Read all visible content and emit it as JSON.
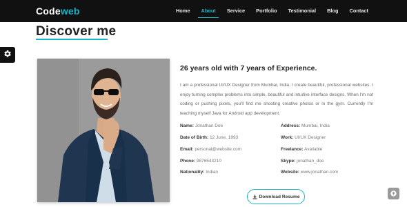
{
  "brand": {
    "part1": "Code",
    "part2": "web"
  },
  "nav": {
    "items": [
      {
        "label": "Home",
        "active": false
      },
      {
        "label": "About",
        "active": true
      },
      {
        "label": "Service",
        "active": false
      },
      {
        "label": "Portfolio",
        "active": false
      },
      {
        "label": "Testimonial",
        "active": false
      },
      {
        "label": "Blog",
        "active": false
      },
      {
        "label": "Contact",
        "active": false
      }
    ]
  },
  "about": {
    "section_title": "Discover me",
    "headline": "26 years old with 7 years of Experience.",
    "bio": "I am a professional UI/UX Designer from Mumbai, India. I create beautiful, professional websites. I enjoy turning complex problems into simple, beautiful and intuitive interface designs. When I'm not coding or pushing pixels, you'll find me shooting creative photos or in the gym. Currently I'm teaching myself Java for Android app development.",
    "details_left": [
      {
        "key": "Name:",
        "value": "Jonathan Doe"
      },
      {
        "key": "Date of Birth:",
        "value": "12 June, 1993"
      },
      {
        "key": "Email:",
        "value": "personal@website.com"
      },
      {
        "key": "Phone:",
        "value": "9876543210"
      },
      {
        "key": "Nationality:",
        "value": "Indian"
      }
    ],
    "details_right": [
      {
        "key": "Address:",
        "value": "Mumbai, India"
      },
      {
        "key": "Work:",
        "value": "UI/UX Designer"
      },
      {
        "key": "Freelance:",
        "value": "Available"
      },
      {
        "key": "Skype:",
        "value": "jonathan_doe"
      },
      {
        "key": "Website:",
        "value": "www.jonathan.com"
      }
    ],
    "download_label": "Download Resume"
  },
  "icons": {
    "settings": "gear-icon",
    "download": "download-icon",
    "back_to_top": "arrow-up-icon"
  },
  "colors": {
    "accent": "#17b5c8",
    "navbar_bg": "#111111",
    "heading": "#222222",
    "body_text": "#666666"
  }
}
